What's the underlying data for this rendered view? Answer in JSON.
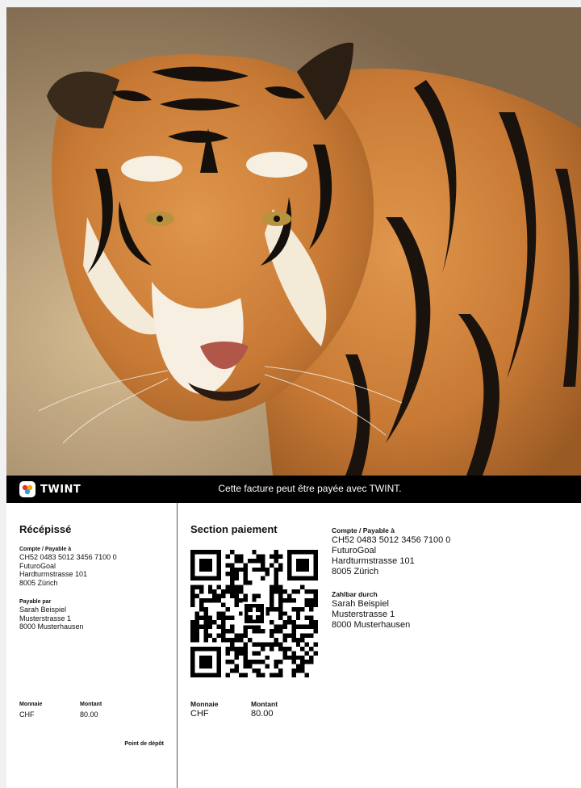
{
  "photo": {
    "subject_icon": "tiger-photo-icon"
  },
  "twint_bar": {
    "brand": "TWINT",
    "message": "Cette facture peut être payée avec TWINT."
  },
  "receipt": {
    "title": "Récépissé",
    "account_label": "Compte / Payable à",
    "account_lines": [
      "CH52 0483 5012 3456 7100 0",
      "FuturoGoal",
      "Hardturmstrasse 101",
      "8005 Zürich"
    ],
    "payer_label": "Payable par",
    "payer_lines": [
      "Sarah Beispiel",
      "Musterstrasse 1",
      "8000 Musterhausen"
    ],
    "currency_label": "Monnaie",
    "currency": "CHF",
    "amount_label": "Montant",
    "amount": "80.00",
    "acceptance_point": "Point de dépôt"
  },
  "payment": {
    "title": "Section paiement",
    "currency_label": "Monnaie",
    "currency": "CHF",
    "amount_label": "Montant",
    "amount": "80.00",
    "account_label": "Compte / Payable à",
    "account_lines": [
      "CH52 0483 5012 3456 7100 0",
      "FuturoGoal",
      "Hardturmstrasse 101",
      "8005 Zürich"
    ],
    "payer_label": "Zahlbar durch",
    "payer_lines": [
      "Sarah Beispiel",
      "Musterstrasse 1",
      "8000 Musterhausen"
    ]
  },
  "colors": {
    "bar": "#000000",
    "paper": "#ffffff",
    "tiger_orange": "#d2833b"
  }
}
